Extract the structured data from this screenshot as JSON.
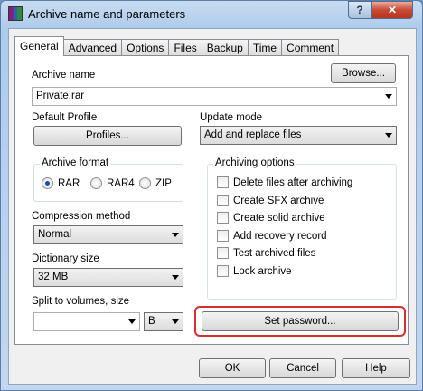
{
  "window": {
    "title": "Archive name and parameters",
    "help_button": "?",
    "close_button": "✕"
  },
  "tabs": [
    {
      "label": "General",
      "active": true
    },
    {
      "label": "Advanced"
    },
    {
      "label": "Options"
    },
    {
      "label": "Files"
    },
    {
      "label": "Backup"
    },
    {
      "label": "Time"
    },
    {
      "label": "Comment"
    }
  ],
  "general": {
    "archive_name_label": "Archive name",
    "browse_button": "Browse...",
    "archive_name_value": "Private.rar",
    "default_profile_label": "Default Profile",
    "profiles_button": "Profiles...",
    "update_mode_label": "Update mode",
    "update_mode_value": "Add and replace files",
    "archive_format": {
      "title": "Archive format",
      "options": [
        {
          "label": "RAR",
          "selected": true
        },
        {
          "label": "RAR4",
          "selected": false
        },
        {
          "label": "ZIP",
          "selected": false
        }
      ]
    },
    "archiving_options": {
      "title": "Archiving options",
      "items": [
        {
          "label": "Delete files after archiving",
          "checked": false
        },
        {
          "label": "Create SFX archive",
          "checked": false
        },
        {
          "label": "Create solid archive",
          "checked": false
        },
        {
          "label": "Add recovery record",
          "checked": false
        },
        {
          "label": "Test archived files",
          "checked": false
        },
        {
          "label": "Lock archive",
          "checked": false
        }
      ]
    },
    "compression_method_label": "Compression method",
    "compression_method_value": "Normal",
    "dictionary_size_label": "Dictionary size",
    "dictionary_size_value": "32 MB",
    "split_label": "Split to volumes, size",
    "split_value": "",
    "split_unit": "B",
    "set_password_button": "Set password..."
  },
  "footer": {
    "ok": "OK",
    "cancel": "Cancel",
    "help": "Help"
  },
  "colors": {
    "highlight": "#d62f2f",
    "radio_dot": "#1a4ea8"
  },
  "icons": {
    "app": "winrar-icon",
    "dropdown": "chevron-down-icon"
  }
}
